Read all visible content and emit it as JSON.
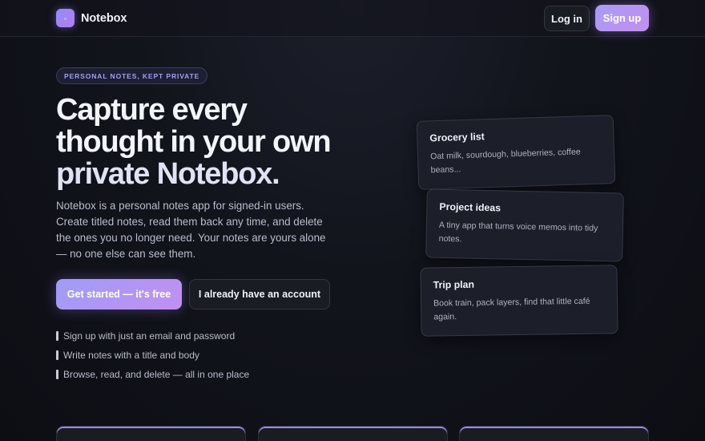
{
  "header": {
    "brand_icon": "notebook-icon",
    "brand_name": "Notebox",
    "login_label": "Log in",
    "signup_label": "Sign up"
  },
  "hero": {
    "badge": "PERSONAL NOTES, KEPT PRIVATE",
    "headline_lines": [
      "Capture every",
      "thought in your own",
      "private Notebox."
    ],
    "lede": "Notebox is a personal notes app for signed-in users. Create titled notes, read them back any time, and delete the ones you no longer need. Your notes are yours alone — no one else can see them.",
    "cta_primary": "Get started — it's free",
    "cta_secondary": "I already have an account",
    "features": [
      "Sign up with just an email and password",
      "Write notes with a title and body",
      "Browse, read, and delete — all in one place"
    ]
  },
  "notes": [
    {
      "title": "Grocery list",
      "body": "Oat milk, sourdough, blueberries, coffee beans..."
    },
    {
      "title": "Project ideas",
      "body": "A tiny app that turns voice memos into tidy notes."
    },
    {
      "title": "Trip plan",
      "body": "Book train, pack layers, find that little café again."
    }
  ],
  "colors": {
    "accent": "#a99bf6",
    "accent_secondary": "#c48ef0",
    "background": "#12141c",
    "card": "#1c1f2a"
  }
}
